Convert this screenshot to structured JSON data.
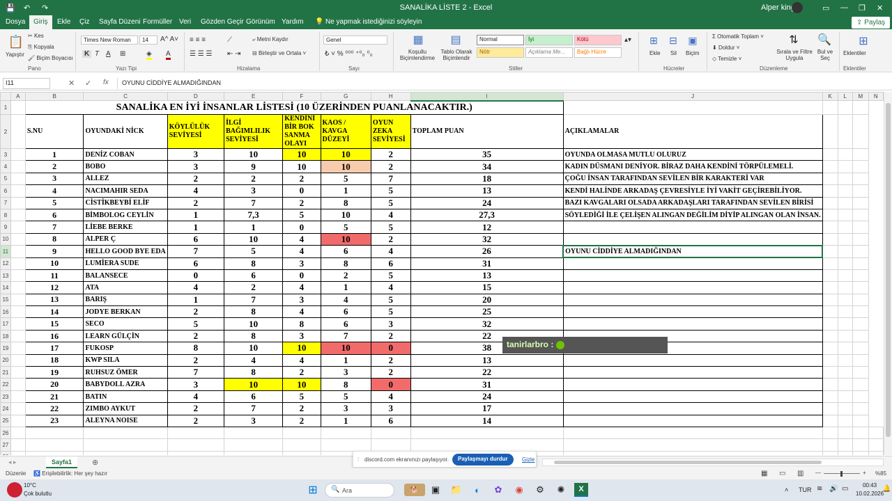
{
  "titlebar": {
    "window_title": "SANALİKA LİSTE 2  -  Excel",
    "user": "Alper king"
  },
  "tabs": [
    "Dosya",
    "Giriş",
    "Ekle",
    "Çiz",
    "Sayfa Düzeni",
    "Formüller",
    "Veri",
    "Gözden Geçir",
    "Görünüm",
    "Yardım"
  ],
  "tell_me": "Ne yapmak istediğinizi söyleyin",
  "share_label": "Paylaş",
  "ribbon": {
    "paste": "Yapıştır",
    "cut": "Kes",
    "copy": "Kopyala",
    "format_painter": "Biçim Boyacısı",
    "font_name": "Times New Roman",
    "font_size": "14",
    "wrap_text": "Metni Kaydır",
    "merge_center": "Birleştir ve Ortala",
    "number_format": "Genel",
    "conditional_format": "Koşullu Biçimlendirme",
    "format_as_table": "Tablo Olarak Biçimlendir",
    "style_normal": "Normal",
    "style_good": "İyi",
    "style_bad": "Kötü",
    "style_neutral": "Nötr",
    "style_explanatory": "Açıklama Me...",
    "style_linked": "Bağlı Hücre",
    "insert": "Ekle",
    "delete": "Sil",
    "format": "Biçim",
    "autosum": "Otomatik Toplam",
    "fill": "Doldur",
    "clear": "Temizle",
    "sort_filter": "Sırala ve Filtre Uygula",
    "find_select": "Bul ve Seç",
    "addins": "Eklentiler",
    "groups": {
      "clipboard": "Pano",
      "font": "Yazı Tipi",
      "alignment": "Hizalama",
      "number": "Sayı",
      "styles": "Stiller",
      "cells": "Hücreler",
      "editing": "Düzenleme",
      "addins": "Eklentiler"
    }
  },
  "formula_bar": {
    "name_box": "I11",
    "content": "OYUNU CİDDİYE ALMADIĞINDAN"
  },
  "sheet": {
    "columns": [
      "A",
      "B",
      "C",
      "D",
      "E",
      "F",
      "G",
      "H",
      "I",
      "J",
      "K",
      "L",
      "M",
      "N"
    ],
    "title": "SANALİKA EN İYİ İNSANLAR LİSTESİ  (10 ÜZERİNDEN PUANLANACAKTIR.)",
    "headers": [
      "S.NU",
      "OYUNDAKİ NİCK",
      "KÖYLÜLÜK SEVİYESİ",
      "İLGİ BAĞIMLILIK SEVİYESİ",
      "KENDİNİ BİR BOK SANMA OLAYI",
      "KAOS / KAVGA DÜZEYİ",
      "OYUN ZEKA SEVİYESİ",
      "TOPLAM PUAN",
      "AÇIKLAMALAR"
    ],
    "rows": [
      [
        "1",
        "DENİZ COBAN",
        "3",
        "10",
        "10",
        "10",
        "2",
        "35",
        "OYUNDA OLMASA MUTLU OLURUZ"
      ],
      [
        "2",
        "BOBO",
        "3",
        "9",
        "10",
        "10",
        "2",
        "34",
        "KADIN DÜSMANI DENİYOR. BİRAZ DAHA KENDİNİ TÖRPÜLEMELİ."
      ],
      [
        "3",
        "ALLEZ",
        "2",
        "2",
        "2",
        "5",
        "7",
        "18",
        "ÇOĞU İNSAN TARAFINDAN SEVİLEN BİR KARAKTERİ VAR"
      ],
      [
        "4",
        "NACIMAHIR SEDA",
        "4",
        "3",
        "0",
        "1",
        "5",
        "13",
        "KENDİ HALİNDE ARKADAŞ ÇEVRESİYLE İYİ VAKİT GEÇİREBİLİYOR."
      ],
      [
        "5",
        "CİSTİKBEYBİ ELİF",
        "2",
        "7",
        "2",
        "8",
        "5",
        "24",
        "BAZI KAVGALARI OLSADA ARKADAŞLARI TARAFINDAN SEVİLEN BİRİSİ"
      ],
      [
        "6",
        "BİMBOLOG CEYLİN",
        "1",
        "7,3",
        "5",
        "10",
        "4",
        "27,3",
        "SÖYLEDİĞİ İLE ÇELİŞEN ALINGAN DEĞİLİM DİYİP ALINGAN OLAN İNSAN."
      ],
      [
        "7",
        "LİEBE BERKE",
        "1",
        "1",
        "0",
        "5",
        "5",
        "12",
        ""
      ],
      [
        "8",
        "ALPER Ç",
        "6",
        "10",
        "4",
        "10",
        "2",
        "32",
        ""
      ],
      [
        "9",
        "HELLO GOOD BYE EDA",
        "7",
        "5",
        "4",
        "6",
        "4",
        "26",
        "OYUNU CİDDİYE ALMADIĞINDAN"
      ],
      [
        "10",
        "LUMİERA SUDE",
        "6",
        "8",
        "3",
        "8",
        "6",
        "31",
        ""
      ],
      [
        "11",
        "BALANSECE",
        "0",
        "6",
        "0",
        "2",
        "5",
        "13",
        ""
      ],
      [
        "12",
        "ATA",
        "4",
        "2",
        "4",
        "1",
        "4",
        "15",
        ""
      ],
      [
        "13",
        "BARIŞ",
        "1",
        "7",
        "3",
        "4",
        "5",
        "20",
        ""
      ],
      [
        "14",
        "JODYE BERKAN",
        "2",
        "8",
        "4",
        "6",
        "5",
        "25",
        ""
      ],
      [
        "15",
        "SECO",
        "5",
        "10",
        "8",
        "6",
        "3",
        "32",
        ""
      ],
      [
        "16",
        "LEARN GÜLÇİN",
        "2",
        "8",
        "3",
        "7",
        "2",
        "22",
        ""
      ],
      [
        "17",
        "FUKOSP",
        "8",
        "10",
        "10",
        "10",
        "0",
        "38",
        ""
      ],
      [
        "18",
        "KWP SILA",
        "2",
        "4",
        "4",
        "1",
        "2",
        "13",
        ""
      ],
      [
        "19",
        "RUHSUZ ÖMER",
        "7",
        "8",
        "2",
        "3",
        "2",
        "22",
        ""
      ],
      [
        "20",
        "BABYDOLL AZRA",
        "3",
        "10",
        "10",
        "8",
        "0",
        "31",
        ""
      ],
      [
        "21",
        "BATIN",
        "4",
        "6",
        "5",
        "5",
        "4",
        "24",
        ""
      ],
      [
        "22",
        "ZIMBO AYKUT",
        "2",
        "7",
        "2",
        "3",
        "3",
        "17",
        ""
      ],
      [
        "23",
        "ALEYNA NOISE",
        "2",
        "3",
        "2",
        "1",
        "6",
        "14",
        ""
      ]
    ],
    "row_numbers": [
      "1",
      "2",
      "3",
      "4",
      "5",
      "6",
      "7",
      "8",
      "9",
      "10",
      "11",
      "12",
      "13",
      "14",
      "15",
      "16",
      "17",
      "18",
      "19",
      "20",
      "21",
      "22",
      "23",
      "24",
      "25",
      "26",
      "27",
      "28",
      "29"
    ],
    "colors": {
      "yellow": "#ffff00",
      "red": "#f26b6b",
      "orange": "#f8cbad"
    }
  },
  "overlay": {
    "user_tag": "tanirlarbro :"
  },
  "sheet_tab": "Sayfa1",
  "screen_share": {
    "text": "discord.com ekranınızı paylaşıyor.",
    "stop_button": "Paylaşmayı durdur",
    "hide": "Gizle"
  },
  "status": {
    "mode": "Düzenle",
    "accessibility": "Erişilebilirlik: Her şey hazır",
    "zoom": "%85"
  },
  "taskbar": {
    "weather_temp": "10°C",
    "weather_desc": "Çok bulutlu",
    "search": "Ara",
    "lang": "TUR",
    "time": "00:43",
    "date": "10.02.2026"
  }
}
